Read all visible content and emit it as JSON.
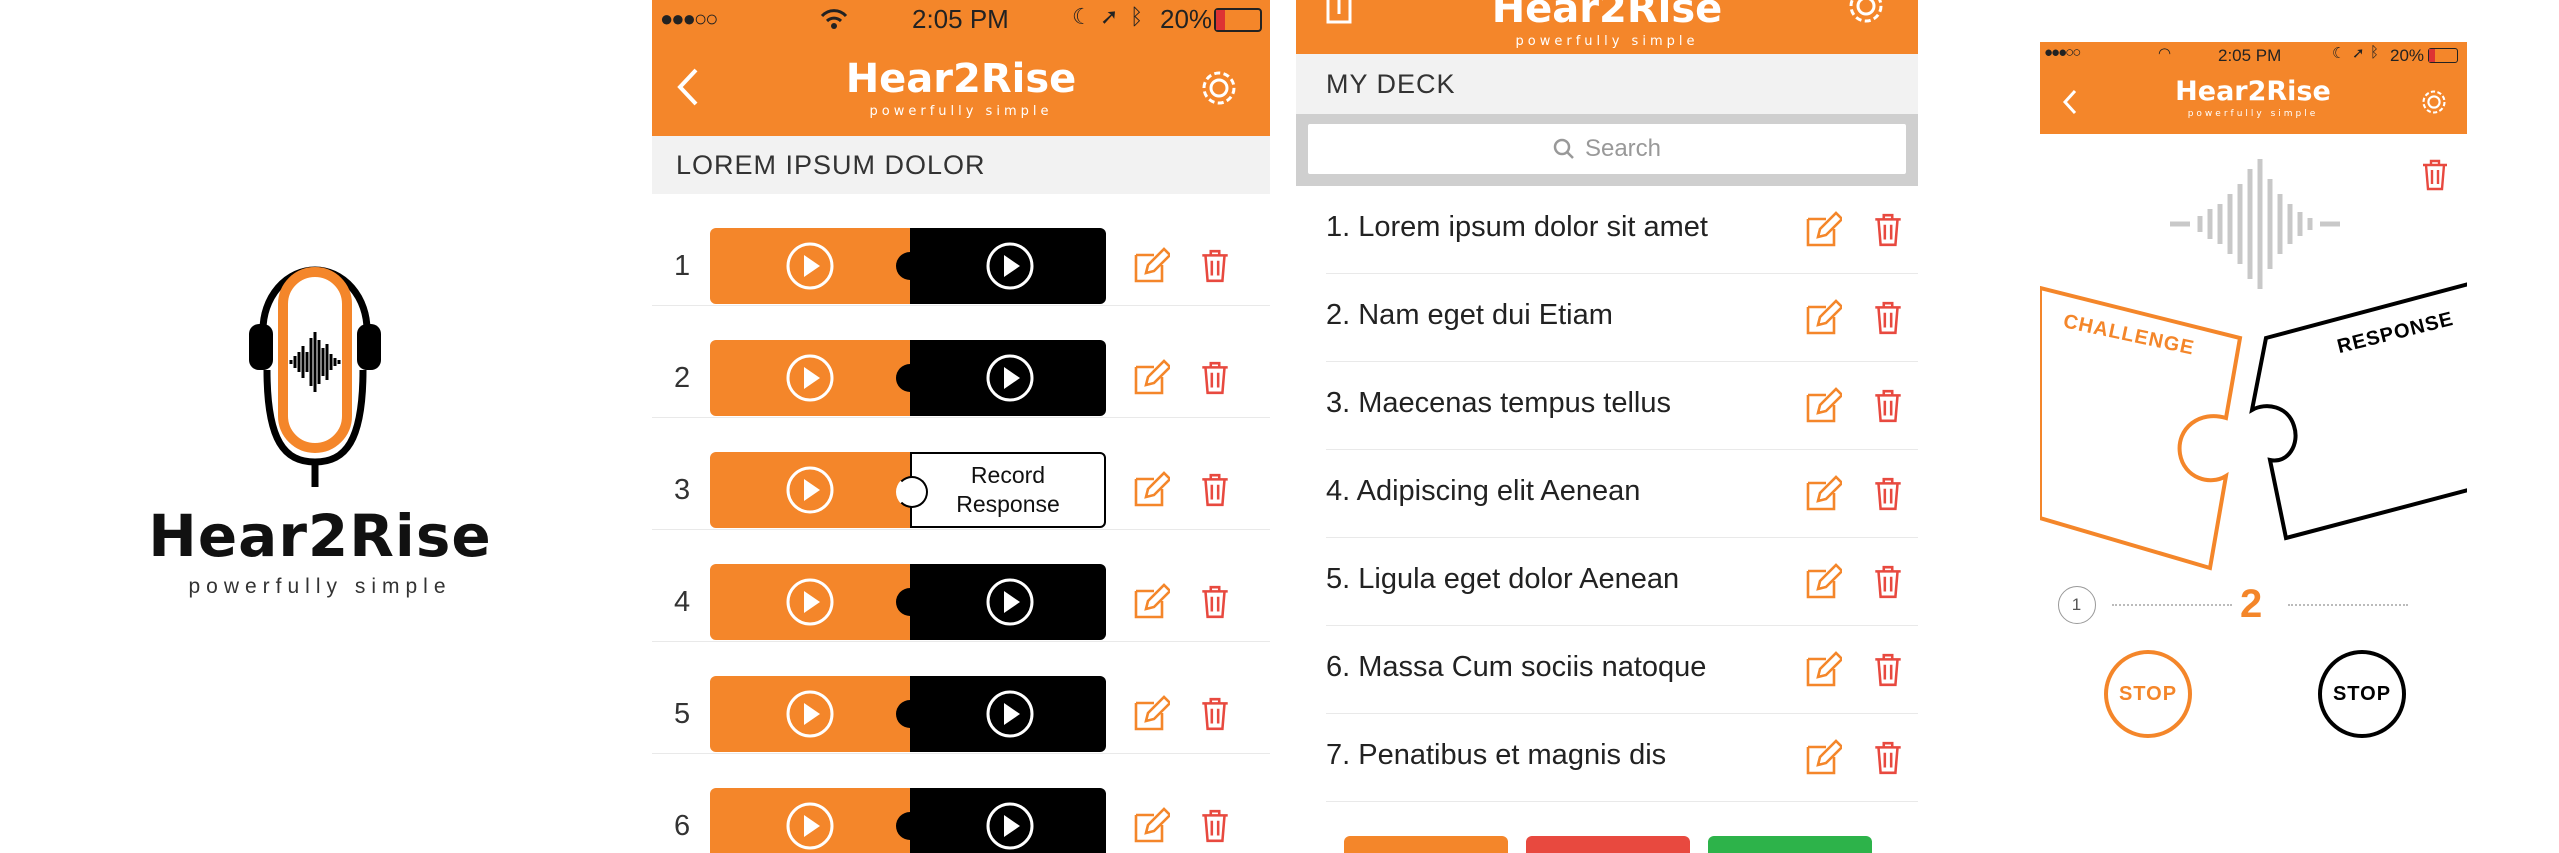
{
  "logo": {
    "name": "Hear2Rise",
    "tagline": "powerfully simple"
  },
  "colors": {
    "brand_orange": "#F4862A",
    "delete_red": "#E8493F",
    "black": "#000000"
  },
  "screen1": {
    "status": {
      "time": "2:05 PM",
      "battery": "20%"
    },
    "header": {
      "title": "Hear2Rise",
      "tagline": "powerfully simple"
    },
    "section_title": "LOREM IPSUM DOLOR",
    "rows": [
      {
        "number": "1",
        "response": "play"
      },
      {
        "number": "2",
        "response": "play"
      },
      {
        "number": "3",
        "response": "record",
        "response_label_line1": "Record",
        "response_label_line2": "Response"
      },
      {
        "number": "4",
        "response": "play"
      },
      {
        "number": "5",
        "response": "play"
      },
      {
        "number": "6",
        "response": "play"
      }
    ]
  },
  "screen2": {
    "header": {
      "title": "Hear2Rise",
      "tagline": "powerfully simple"
    },
    "section_title": "MY DECK",
    "search": {
      "placeholder": "Search"
    },
    "items": [
      "1. Lorem ipsum dolor sit amet",
      "2. Nam eget dui Etiam",
      "3. Maecenas tempus tellus",
      "4. Adipiscing elit Aenean",
      "5. Ligula eget dolor Aenean",
      "6. Massa Cum sociis natoque",
      "7. Penatibus et magnis dis"
    ],
    "bottom_button_colors": [
      "#F4862A",
      "#E8493F",
      "#2DB34A"
    ]
  },
  "screen3": {
    "status": {
      "time": "2:05 PM",
      "battery": "20%"
    },
    "header": {
      "title": "Hear2Rise",
      "tagline": "powerfully simple"
    },
    "challenge_label": "CHALLENGE",
    "response_label": "RESPONSE",
    "pager": {
      "previous": "1",
      "current": "2"
    },
    "stop_left": "STOP",
    "stop_right": "STOP"
  }
}
